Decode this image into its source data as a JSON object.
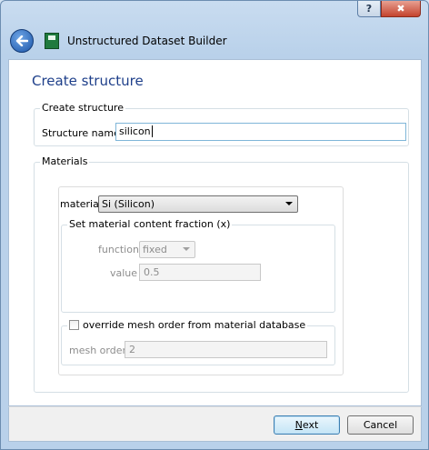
{
  "window": {
    "help_label": "?",
    "close_label": "✖",
    "title": "Unstructured Dataset Builder"
  },
  "page": {
    "heading": "Create structure"
  },
  "create_structure": {
    "group_title": "Create structure",
    "name_label": "Structure name",
    "name_value": "silicon"
  },
  "materials": {
    "group_title": "Materials",
    "material_label": "material",
    "material_value": "Si (Silicon)",
    "fraction": {
      "group_title": "Set material content fraction (x)",
      "function_label": "function",
      "function_value": "fixed",
      "value_label": "value",
      "value_value": "0.5"
    },
    "mesh": {
      "override_label": "override mesh order from material database",
      "override_checked": false,
      "mesh_order_label": "mesh order",
      "mesh_order_value": "2"
    }
  },
  "footer": {
    "next_label": "Next",
    "next_mnemonic": "N",
    "next_rest": "ext",
    "cancel_label": "Cancel"
  },
  "icons": [
    "back-arrow-icon",
    "app-icon",
    "help-icon",
    "close-icon",
    "chevron-down-icon",
    "checkbox"
  ]
}
